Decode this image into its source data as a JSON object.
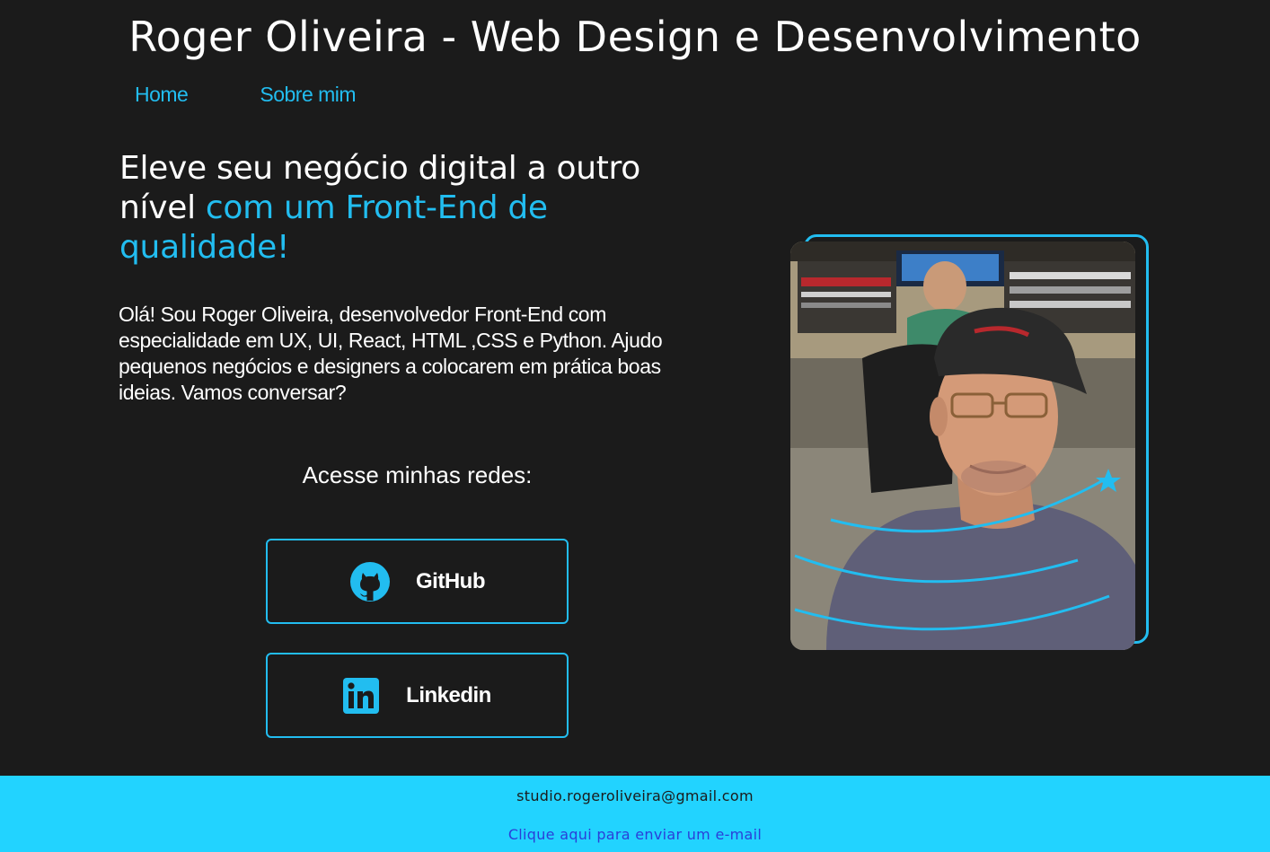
{
  "header": {
    "title": "Roger Oliveira - Web Design e Desenvolvimento"
  },
  "nav": {
    "items": [
      {
        "label": "Home"
      },
      {
        "label": "Sobre mim"
      }
    ]
  },
  "hero": {
    "headline_plain": "Eleve seu negócio digital a outro nível ",
    "headline_accent": "com um Front-End de qualidade!",
    "intro": "Olá! Sou Roger Oliveira, desenvolvedor Front-End com especialidade em UX, UI, React, HTML ,CSS e Python. Ajudo pequenos negócios e designers a colocarem em prática boas ideias. Vamos conversar?"
  },
  "social": {
    "title": "Acesse minhas redes:",
    "github_label": "GitHub",
    "linkedin_label": "Linkedin",
    "github_icon": "github-icon",
    "linkedin_icon": "linkedin-icon"
  },
  "footer": {
    "email": "studio.rogeroliveira@gmail.com",
    "link_text": "Clique aqui para enviar um e-mail"
  },
  "colors": {
    "background": "#1b1b1b",
    "accent": "#22bdf0",
    "footer_bg": "#22d3ff",
    "footer_link": "#2a3fd8"
  }
}
